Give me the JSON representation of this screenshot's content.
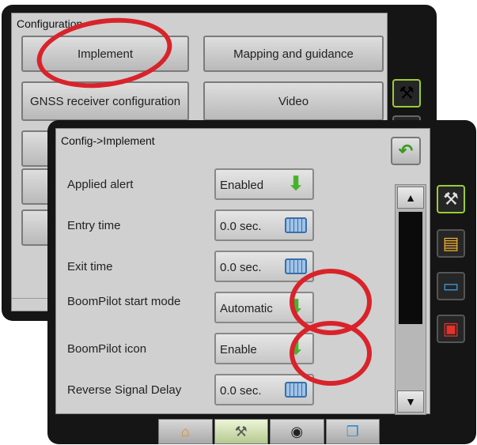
{
  "config_screen": {
    "title": "Configuration",
    "buttons": {
      "implement": "Implement",
      "mapping": "Mapping and guidance",
      "gnss": "GNSS receiver configuration",
      "video": "Video"
    }
  },
  "implement_screen": {
    "title": "Config->Implement",
    "rows": [
      {
        "label": "Applied alert",
        "value": "Enabled",
        "control": "down-arrow"
      },
      {
        "label": "Entry time",
        "value": "0.0 sec.",
        "control": "keyboard"
      },
      {
        "label": "Exit time",
        "value": "0.0 sec.",
        "control": "keyboard"
      },
      {
        "label": "BoomPilot start mode",
        "value": "Automatic",
        "control": "down-arrow"
      },
      {
        "label": "BoomPilot icon",
        "value": "Enable",
        "control": "down-arrow"
      },
      {
        "label": "Reverse Signal Delay",
        "value": "0.0 sec.",
        "control": "keyboard"
      }
    ]
  },
  "icons": {
    "back": "back-arrow-icon",
    "tools": "tools-icon",
    "console": "console-icon",
    "display": "display-icon",
    "toolbox": "toolbox-icon",
    "home": "home-icon",
    "camera": "camera-icon",
    "windows": "windows-icon"
  },
  "colors": {
    "accent_green": "#9acd32",
    "highlight_red": "#d9232b",
    "arrow_green": "#45b32a"
  }
}
